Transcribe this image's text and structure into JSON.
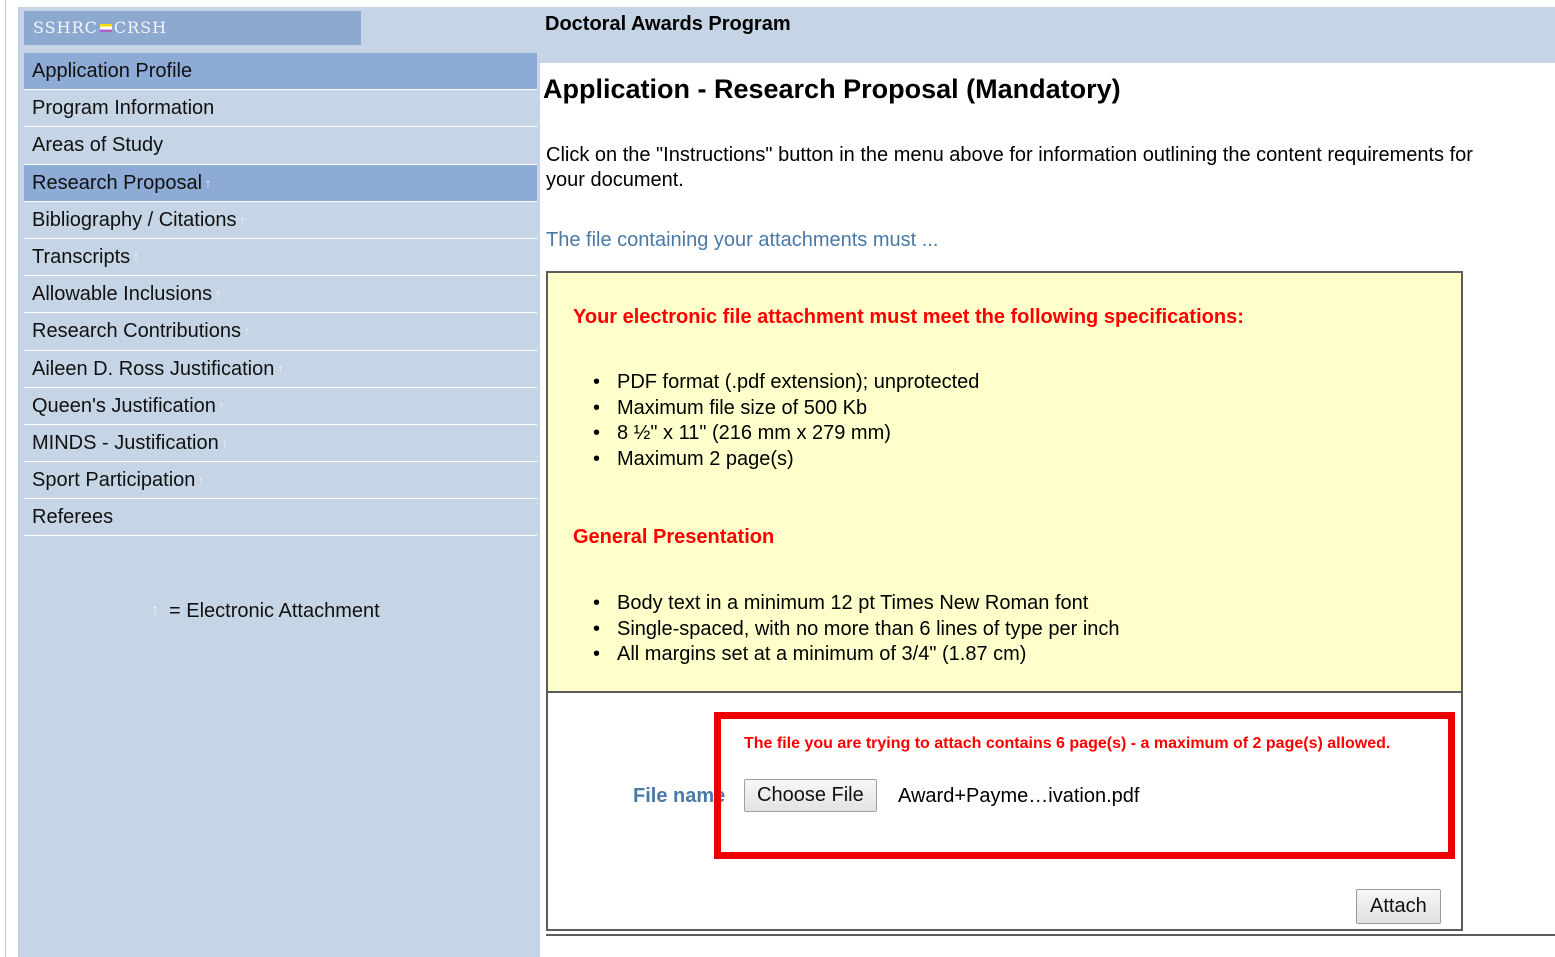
{
  "brand": {
    "left": "SSHRC",
    "right": "CRSH"
  },
  "sidebar": {
    "items": [
      {
        "label": "Application Profile",
        "active": true,
        "attachment": false
      },
      {
        "label": "Program Information",
        "active": false,
        "attachment": false
      },
      {
        "label": "Areas of Study",
        "active": false,
        "attachment": false
      },
      {
        "label": "Research Proposal",
        "active": true,
        "attachment": true
      },
      {
        "label": "Bibliography / Citations",
        "active": false,
        "attachment": true
      },
      {
        "label": "Transcripts",
        "active": false,
        "attachment": true
      },
      {
        "label": "Allowable Inclusions",
        "active": false,
        "attachment": true
      },
      {
        "label": "Research Contributions",
        "active": false,
        "attachment": true
      },
      {
        "label": "Aileen D. Ross Justification",
        "active": false,
        "attachment": true
      },
      {
        "label": "Queen's Justification",
        "active": false,
        "attachment": true
      },
      {
        "label": "MINDS - Justification",
        "active": false,
        "attachment": true
      },
      {
        "label": "Sport Participation",
        "active": false,
        "attachment": true
      },
      {
        "label": "Referees",
        "active": false,
        "attachment": false
      }
    ],
    "legend": "= Electronic Attachment"
  },
  "header": {
    "program": "Doctoral Awards Program"
  },
  "main": {
    "title": "Application - Research Proposal (Mandatory)",
    "instructions": "Click on the \"Instructions\" button in the menu above for information outlining the content requirements for your document.",
    "file_must": "The file containing your attachments must ...",
    "spec_heading": "Your electronic file attachment must meet the following specifications:",
    "specs": [
      "PDF format (.pdf extension); unprotected",
      "Maximum file size of 500 Kb",
      "8 ½\" x 11\" (216 mm x 279 mm)",
      "Maximum 2 page(s)"
    ],
    "general_heading": "General Presentation",
    "general": [
      "Body text in a minimum 12 pt Times New Roman font",
      "Single-spaced, with no more than 6 lines of type per inch",
      "All margins set at a minimum of 3/4\" (1.87 cm)"
    ],
    "error": "The file you are trying to attach contains 6 page(s) - a maximum of 2 page(s) allowed.",
    "file_label": "File name",
    "choose_file": "Choose File",
    "file_chosen": "Award+Payme…ivation.pdf",
    "attach": "Attach"
  },
  "colors": {
    "sidebar_bg": "#c6d5e5",
    "active_bg": "#8dabd5",
    "spec_bg": "#ffffcc",
    "error_red": "#ff0000",
    "link_blue": "#4a79a6"
  },
  "icons": {
    "attachment": "up-arrow-icon"
  }
}
